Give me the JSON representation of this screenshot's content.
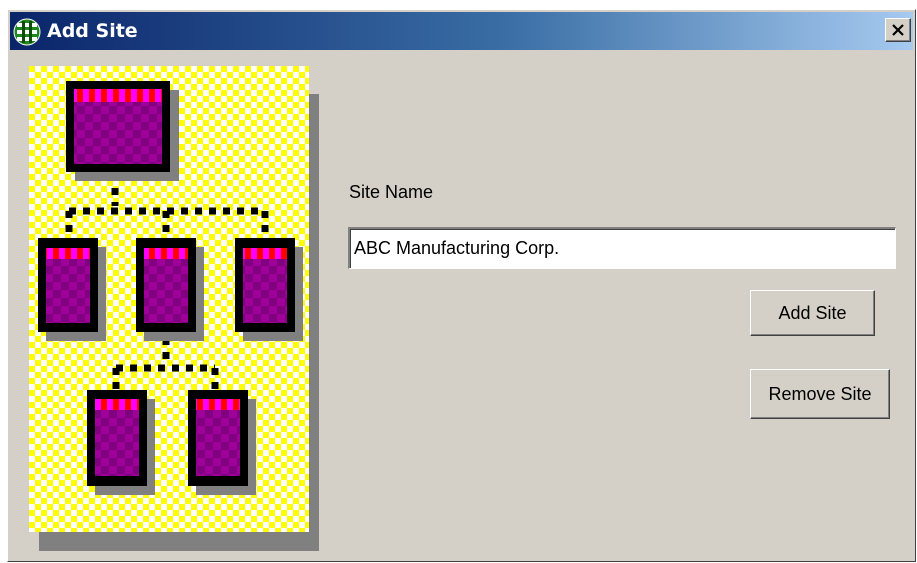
{
  "window": {
    "title": "Add Site",
    "app_icon": "globe-network-icon",
    "close_icon": "close-icon"
  },
  "illustration": {
    "icon": "site-hierarchy-icon",
    "colors": {
      "checker_a": "#ffff00",
      "checker_b": "#ffffff",
      "node_frame": "#000000",
      "node_body_a": "#800080",
      "node_body_b": "#ff00ff",
      "node_header_a": "#ff0000",
      "node_header_b": "#ff00ff",
      "shadow": "#808080"
    }
  },
  "form": {
    "site_name_label": "Site Name",
    "site_name_value": "ABC Manufacturing Corp.",
    "add_button_label": "Add Site",
    "remove_button_label": "Remove Site"
  },
  "theme": {
    "titlebar_start": "#0a246a",
    "titlebar_end": "#a6caf0",
    "dialog_bg": "#d4d0c8"
  }
}
